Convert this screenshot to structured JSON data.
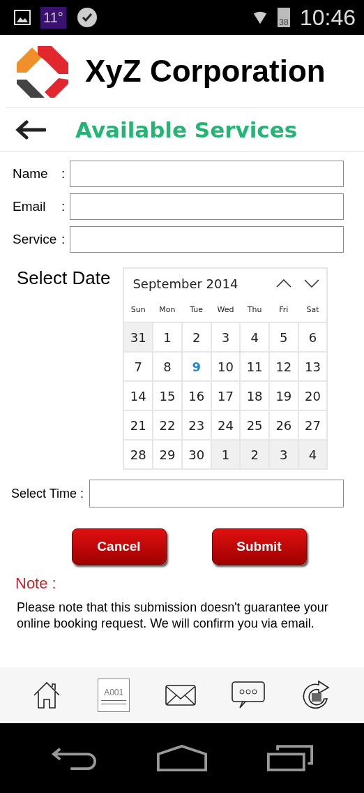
{
  "status_bar": {
    "weather": "11°",
    "battery": "38",
    "time": "10:46"
  },
  "header": {
    "company": "XyZ Corporation"
  },
  "title_bar": {
    "title": "Available Services"
  },
  "form": {
    "fields": [
      {
        "label": "Name",
        "separator": ":"
      },
      {
        "label": "Email",
        "separator": ":"
      },
      {
        "label": "Service",
        "separator": ":"
      }
    ]
  },
  "date": {
    "label": "Select Date",
    "month": "September 2014",
    "weekdays": [
      "Sun",
      "Mon",
      "Tue",
      "Wed",
      "Thu",
      "Fri",
      "Sat"
    ],
    "days": [
      {
        "day": "31",
        "outside": true,
        "today": false
      },
      {
        "day": "1",
        "outside": false,
        "today": false
      },
      {
        "day": "2",
        "outside": false,
        "today": false
      },
      {
        "day": "3",
        "outside": false,
        "today": false
      },
      {
        "day": "4",
        "outside": false,
        "today": false
      },
      {
        "day": "5",
        "outside": false,
        "today": false
      },
      {
        "day": "6",
        "outside": false,
        "today": false
      },
      {
        "day": "7",
        "outside": false,
        "today": false
      },
      {
        "day": "8",
        "outside": false,
        "today": false
      },
      {
        "day": "9",
        "outside": false,
        "today": true
      },
      {
        "day": "10",
        "outside": false,
        "today": false
      },
      {
        "day": "11",
        "outside": false,
        "today": false
      },
      {
        "day": "12",
        "outside": false,
        "today": false
      },
      {
        "day": "13",
        "outside": false,
        "today": false
      },
      {
        "day": "14",
        "outside": false,
        "today": false
      },
      {
        "day": "15",
        "outside": false,
        "today": false
      },
      {
        "day": "16",
        "outside": false,
        "today": false
      },
      {
        "day": "17",
        "outside": false,
        "today": false
      },
      {
        "day": "18",
        "outside": false,
        "today": false
      },
      {
        "day": "19",
        "outside": false,
        "today": false
      },
      {
        "day": "20",
        "outside": false,
        "today": false
      },
      {
        "day": "21",
        "outside": false,
        "today": false
      },
      {
        "day": "22",
        "outside": false,
        "today": false
      },
      {
        "day": "23",
        "outside": false,
        "today": false
      },
      {
        "day": "24",
        "outside": false,
        "today": false
      },
      {
        "day": "25",
        "outside": false,
        "today": false
      },
      {
        "day": "26",
        "outside": false,
        "today": false
      },
      {
        "day": "27",
        "outside": false,
        "today": false
      },
      {
        "day": "28",
        "outside": false,
        "today": false
      },
      {
        "day": "29",
        "outside": false,
        "today": false
      },
      {
        "day": "30",
        "outside": false,
        "today": false
      },
      {
        "day": "1",
        "outside": true,
        "today": false
      },
      {
        "day": "2",
        "outside": true,
        "today": false
      },
      {
        "day": "3",
        "outside": true,
        "today": false
      },
      {
        "day": "4",
        "outside": true,
        "today": false
      }
    ]
  },
  "time": {
    "label": "Select Time :"
  },
  "buttons": [
    "Cancel",
    "Submit"
  ],
  "note": {
    "title": "Note :",
    "text": "Please note that this submission doesn't guarantee your online booking request. We will confirm you via email."
  },
  "bottom_nav": {
    "ticket_code": "A001"
  }
}
